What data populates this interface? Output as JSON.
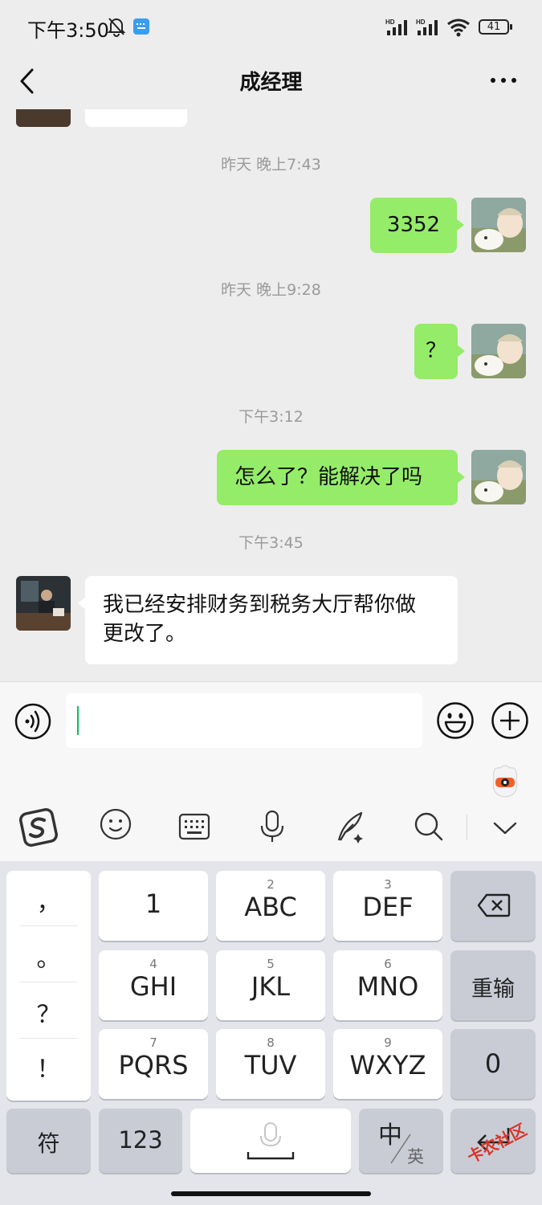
{
  "status_bar": {
    "time": "下午3:50",
    "battery": "41",
    "signal_label_1": "HD",
    "signal_label_2": "HD"
  },
  "nav": {
    "title": "成经理"
  },
  "messages": [
    {
      "timestamp": "昨天 晚上7:43",
      "direction": "out",
      "text": "3352"
    },
    {
      "timestamp": "昨天 晚上9:28",
      "direction": "out",
      "text": "？"
    },
    {
      "timestamp": "下午3:12",
      "direction": "out",
      "text": "怎么了？能解决了吗"
    },
    {
      "timestamp": "下午3:45",
      "direction": "in",
      "text_line1": "我已经安排财务到税务大厅帮你做",
      "text_line2": "更改了。"
    }
  ],
  "input": {
    "value": ""
  },
  "keyboard": {
    "punctuation": [
      "，",
      "。",
      "？",
      "！"
    ],
    "keys": [
      {
        "num": "",
        "label": "1"
      },
      {
        "num": "2",
        "label": "ABC"
      },
      {
        "num": "3",
        "label": "DEF"
      },
      {
        "num": "4",
        "label": "GHI"
      },
      {
        "num": "5",
        "label": "JKL"
      },
      {
        "num": "6",
        "label": "MNO"
      },
      {
        "num": "7",
        "label": "PQRS"
      },
      {
        "num": "8",
        "label": "TUV"
      },
      {
        "num": "9",
        "label": "WXYZ"
      }
    ],
    "reenter": "重输",
    "zero": "0",
    "symbol": "符",
    "digits": "123",
    "lang_main": "中",
    "lang_sub": "英"
  },
  "watermark": "卡农社区",
  "colors": {
    "outgoing_bubble": "#95ec69",
    "incoming_bubble": "#ffffff",
    "background": "#ededed",
    "caret": "#07c160"
  }
}
